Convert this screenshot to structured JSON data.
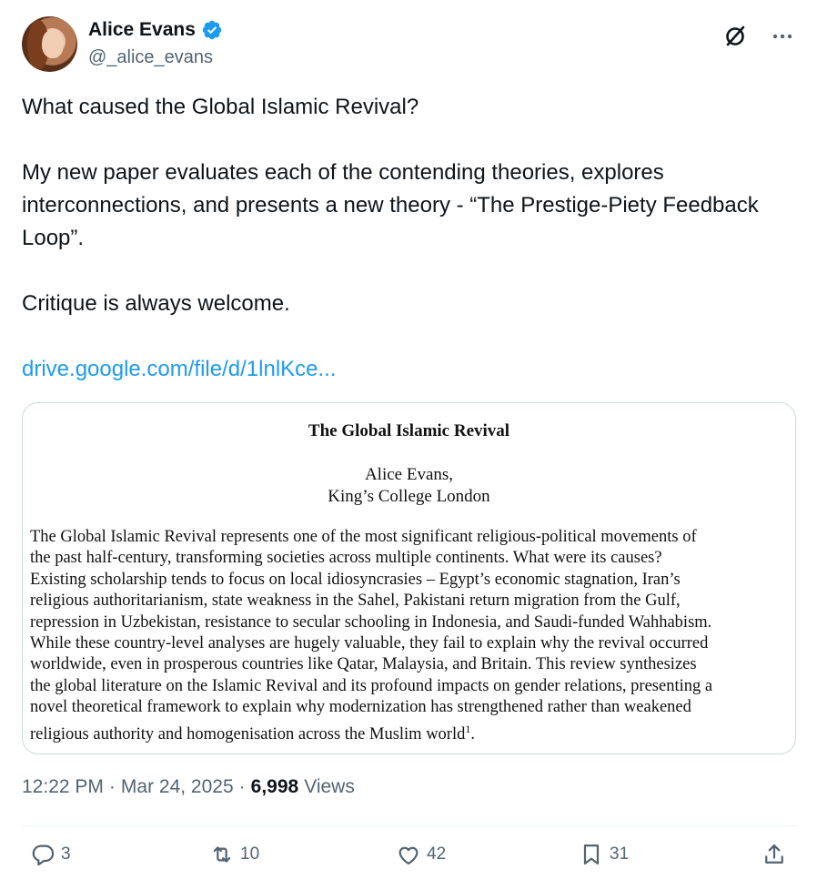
{
  "author": {
    "display_name": "Alice Evans",
    "handle": "@_alice_evans",
    "verified": true
  },
  "header_icons": [
    "grok-slash-icon",
    "more-icon"
  ],
  "tweet": {
    "text_line_1": "What caused the Global Islamic Revival?",
    "text_line_2": "My new paper evaluates each of the contending theories, explores interconnections, and presents a new theory - “The Prestige-Piety Feedback Loop”.",
    "text_line_3": "Critique is always welcome.",
    "link": "drive.google.com/file/d/1lnlKce..."
  },
  "card": {
    "title": "The Global Islamic Revival",
    "author_name": "Alice Evans,",
    "author_affiliation": "King’s College London",
    "abstract_lines": [
      "The Global Islamic Revival represents one of the most significant religious-political movements of",
      "the past half-century, transforming societies across multiple continents. What were its causes?",
      "Existing scholarship tends to focus on local idiosyncrasies – Egypt’s economic stagnation, Iran’s",
      "religious authoritarianism, state weakness in the Sahel, Pakistani return migration from the Gulf,",
      "repression in Uzbekistan, resistance to secular schooling in Indonesia, and Saudi-funded Wahhabism.",
      "While these country-level analyses are hugely valuable, they fail to explain why the revival occurred",
      "worldwide, even in prosperous countries like Qatar, Malaysia, and Britain. This review synthesizes",
      "the global literature on the Islamic Revival and its profound impacts on gender relations, presenting a",
      "novel theoretical framework to explain why modernization has strengthened rather than weakened",
      "religious authority and homogenisation across the Muslim world"
    ],
    "footnote_mark": "1",
    "abstract_end": "."
  },
  "meta": {
    "time": "12:22 PM",
    "separator": "·",
    "date": "Mar 24, 2025",
    "views_count": "6,998",
    "views_label": "Views"
  },
  "actions": {
    "replies": "3",
    "reposts": "10",
    "likes": "42",
    "bookmarks": "31"
  },
  "colors": {
    "link": "#1d9bf0",
    "secondary_text": "#536471",
    "primary_text": "#0f1419",
    "border": "#cfd9de",
    "verified_badge": "#1d9bf0"
  }
}
